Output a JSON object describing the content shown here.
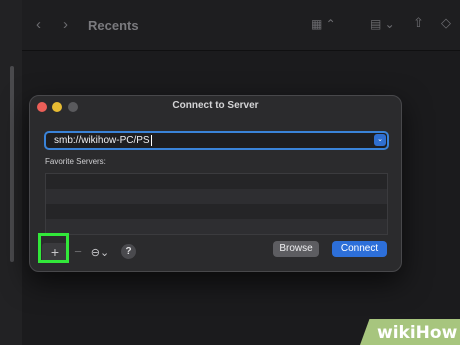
{
  "finder": {
    "title": "Recents",
    "icons": {
      "back": "chevron-left-icon",
      "forward": "chevron-right-icon",
      "view": "grid-view-icon",
      "group": "group-by-icon",
      "share": "share-icon",
      "tag": "tag-icon"
    }
  },
  "dialog": {
    "title": "Connect to Server",
    "server_address": "smb://wikihow-PC/PS",
    "favorites_label": "Favorite Servers:",
    "add_label": "+",
    "remove_label": "−",
    "more_label": "⊖⌄",
    "help_label": "?",
    "browse_label": "Browse",
    "connect_label": "Connect"
  },
  "watermark": {
    "text": "wikiHow"
  },
  "colors": {
    "accent": "#2d6fd9",
    "highlight": "#32e83a",
    "watermark": "#a7c57e"
  }
}
